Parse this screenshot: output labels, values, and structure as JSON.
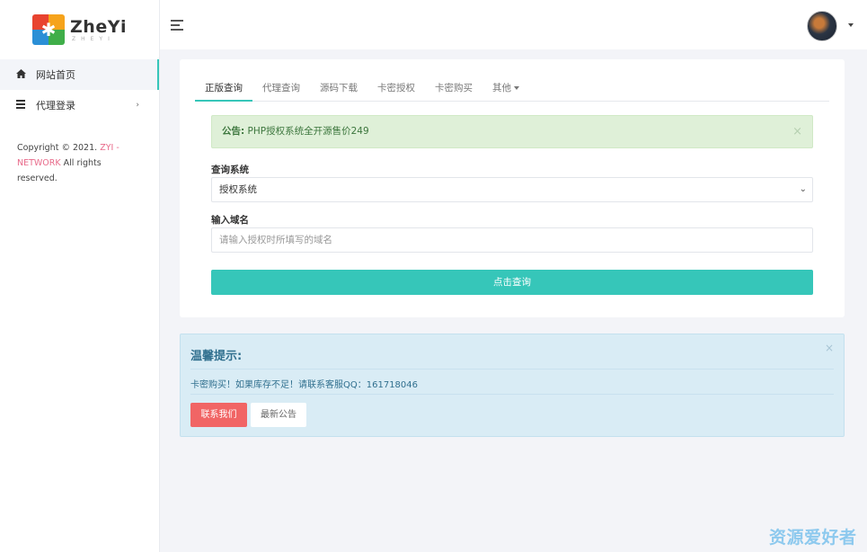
{
  "brand": {
    "name": "ZheYi",
    "sub": "ZHEYI"
  },
  "sidebar": {
    "items": [
      {
        "label": "网站首页",
        "icon": "home-icon"
      },
      {
        "label": "代理登录",
        "icon": "list-icon"
      }
    ],
    "copyright": {
      "prefix": "Copyright © 2021. ",
      "brand": "ZYI - NETWORK",
      "suffix": " All rights reserved."
    }
  },
  "header": {
    "avatar": "user-avatar"
  },
  "tabs": [
    {
      "label": "正版查询"
    },
    {
      "label": "代理查询"
    },
    {
      "label": "源码下载"
    },
    {
      "label": "卡密授权"
    },
    {
      "label": "卡密购买"
    },
    {
      "label": "其他"
    }
  ],
  "notice": {
    "label": "公告:",
    "text": " PHP授权系统全开源售价249",
    "close": "×"
  },
  "form": {
    "system_label": "查询系统",
    "system_value": "授权系统",
    "domain_label": "输入域名",
    "domain_placeholder": "请输入授权时所填写的域名",
    "submit": "点击查询"
  },
  "tip": {
    "title": "温馨提示:",
    "text": "卡密购买！如果库存不足！请联系客服QQ：161718046",
    "contact": "联系我们",
    "news": "最新公告",
    "close": "×"
  },
  "watermark": "资源爱好者",
  "colors": {
    "accent": "#36c6b9",
    "danger": "#f16565",
    "info_bg": "#d9ecf5",
    "success_bg": "#dff0d8"
  }
}
